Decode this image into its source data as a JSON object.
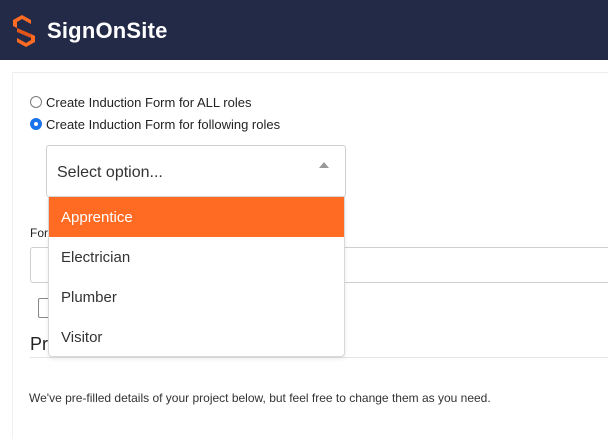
{
  "header": {
    "brand": "SignOnSite",
    "logo_icon": "signonsite-logo-icon",
    "bg_color": "#232a47",
    "accent_color": "#ff6b22"
  },
  "form": {
    "radio_all_label": "Create Induction Form for ALL roles",
    "radio_roles_label": "Create Induction Form for following roles",
    "radio_selected": "following roles",
    "select_placeholder": "Select option...",
    "roles": [
      "Apprentice",
      "Electrician",
      "Plumber",
      "Visitor"
    ],
    "highlighted_role": "Apprentice",
    "partial_label": "For",
    "partial_heading": "Pr",
    "info_text": "We've pre-filled details of your project below, but feel free to change them as you need."
  }
}
